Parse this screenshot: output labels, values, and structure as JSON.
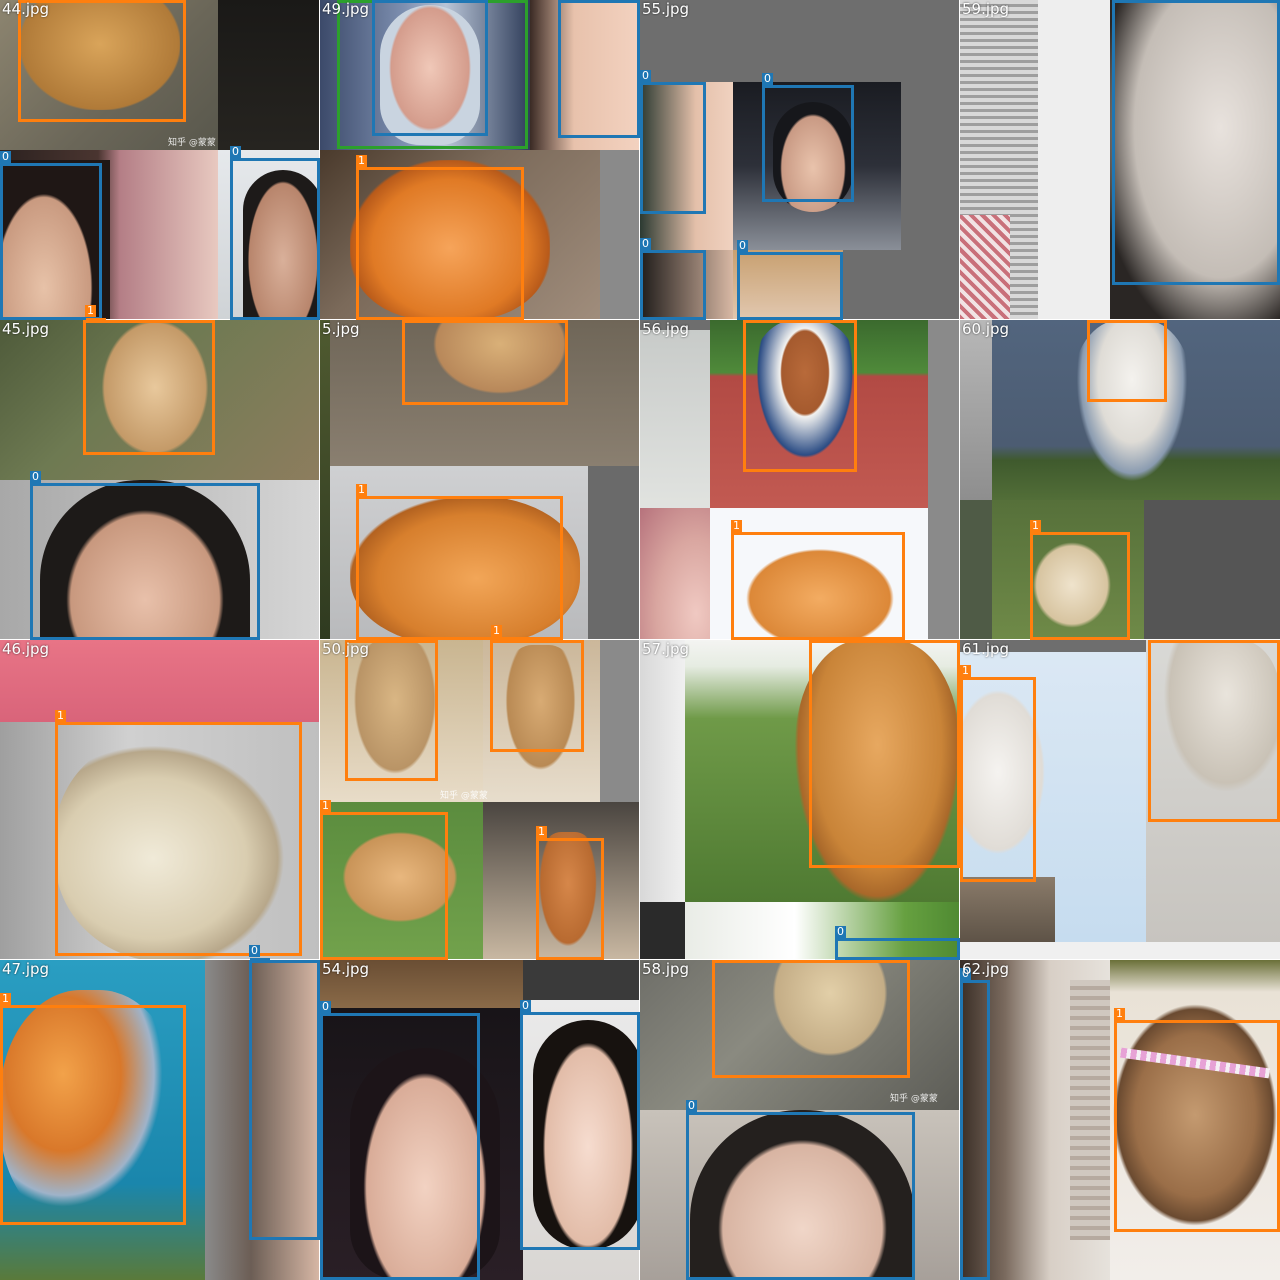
{
  "tiles": [
    {
      "name": "44.jpg",
      "boxes": [
        {
          "cls": "1"
        },
        {
          "cls": "0"
        },
        {
          "cls": "0"
        },
        {
          "cls": "1"
        }
      ],
      "watermark": "知乎 @蒙蒙"
    },
    {
      "name": "49.jpg",
      "boxes": [
        {
          "cls": ""
        },
        {
          "cls": ""
        },
        {
          "cls": ""
        },
        {
          "cls": "1"
        }
      ]
    },
    {
      "name": "55.jpg",
      "boxes": [
        {
          "cls": "0"
        },
        {
          "cls": "0"
        },
        {
          "cls": "0"
        },
        {
          "cls": "0"
        }
      ]
    },
    {
      "name": "59.jpg",
      "boxes": [
        {
          "cls": ""
        }
      ]
    },
    {
      "name": "45.jpg",
      "boxes": [
        {
          "cls": "1"
        },
        {
          "cls": "0"
        }
      ]
    },
    {
      "name": "5.jpg",
      "boxes": [
        {
          "cls": ""
        },
        {
          "cls": "1"
        },
        {
          "cls": "1"
        }
      ]
    },
    {
      "name": "56.jpg",
      "boxes": [
        {
          "cls": ""
        },
        {
          "cls": "1"
        }
      ]
    },
    {
      "name": "60.jpg",
      "boxes": [
        {
          "cls": "1"
        },
        {
          "cls": "1"
        }
      ]
    },
    {
      "name": "46.jpg",
      "boxes": [
        {
          "cls": "1"
        },
        {
          "cls": "0"
        }
      ]
    },
    {
      "name": "50.jpg",
      "boxes": [
        {
          "cls": "1"
        },
        {
          "cls": "1"
        },
        {
          "cls": "1"
        },
        {
          "cls": "1"
        }
      ],
      "watermark": "知乎 @蒙蒙"
    },
    {
      "name": "57.jpg",
      "boxes": [
        {
          "cls": "1"
        },
        {
          "cls": "0"
        }
      ]
    },
    {
      "name": "61.jpg",
      "boxes": [
        {
          "cls": "1"
        },
        {
          "cls": "1"
        }
      ]
    },
    {
      "name": "47.jpg",
      "boxes": [
        {
          "cls": "1"
        },
        {
          "cls": ""
        }
      ]
    },
    {
      "name": "54.jpg",
      "boxes": [
        {
          "cls": "0"
        },
        {
          "cls": "0"
        }
      ]
    },
    {
      "name": "58.jpg",
      "boxes": [
        {
          "cls": "1"
        },
        {
          "cls": "0"
        }
      ],
      "watermark": "知乎 @蒙蒙"
    },
    {
      "name": "62.jpg",
      "boxes": [
        {
          "cls": "0"
        },
        {
          "cls": "1"
        }
      ]
    }
  ],
  "colors": {
    "class_0": "#1f77b4",
    "class_1": "#ff7f0e",
    "extra": "#2ca02c"
  }
}
